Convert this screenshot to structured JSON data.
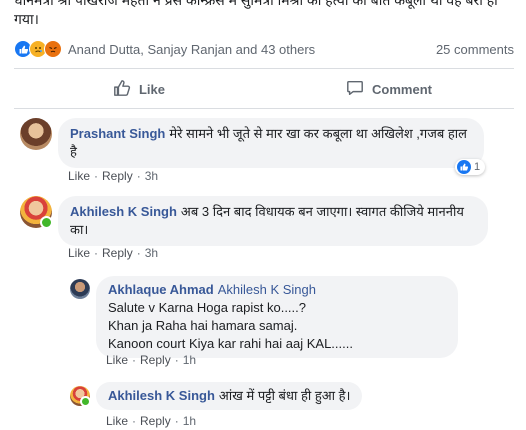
{
  "post": {
    "text": "धानमंत्री श्री पोखराज महतो ने प्रेस कॉन्फ्रेंस में सुमित्रा मिश्रा की हत्या की बात कबूली थी वह बरी हो गया।"
  },
  "reactions": {
    "names": "Anand Dutta, Sanjay Ranjan and 43 others",
    "comments_count": "25 comments",
    "icons": [
      "like-icon",
      "sad-icon",
      "angry-icon"
    ]
  },
  "actions": {
    "like": "Like",
    "comment": "Comment"
  },
  "comments": [
    {
      "author": "Prashant Singh",
      "text": "मेरे सामने भी जूते से मार खा कर कबूला था अखिलेश ,गजब हाल है",
      "like": "Like",
      "reply": "Reply",
      "time": "3h",
      "reaction_count": "1"
    },
    {
      "author": "Akhilesh K Singh",
      "text": "अब 3 दिन बाद विधायक बन जाएगा। स्वागत कीजिये माननीय का।",
      "like": "Like",
      "reply": "Reply",
      "time": "3h"
    }
  ],
  "replies": [
    {
      "author": "Akhlaque Ahmad",
      "mention": "Akhilesh K Singh",
      "line1": "Salute v Karna Hoga rapist ko.....?",
      "line2": "Khan ja Raha hai hamara samaj.",
      "line3": "Kanoon court Kiya kar rahi hai aaj KAL......",
      "like": "Like",
      "reply": "Reply",
      "time": "1h"
    },
    {
      "author": "Akhilesh K Singh",
      "text": "आंख में पट्टी बंधा ही हुआ है।",
      "like": "Like",
      "reply": "Reply",
      "time": "1h"
    }
  ],
  "colors": {
    "link_blue": "#385898",
    "like_blue": "#1877f2",
    "bubble_gray": "#f2f3f5",
    "online_green": "#42b72a"
  }
}
